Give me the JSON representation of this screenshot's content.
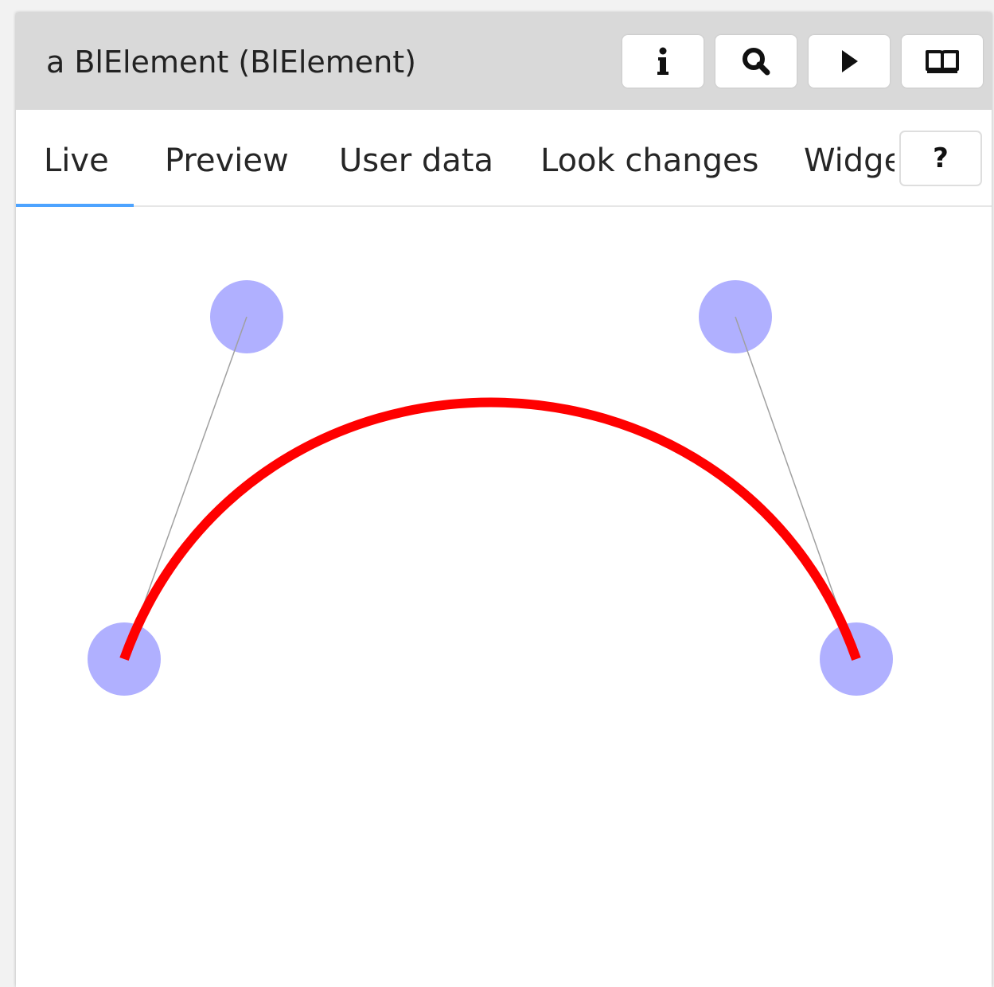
{
  "window": {
    "title": "a BlElement (BlElement)"
  },
  "toolbar": {
    "buttons": [
      {
        "name": "info",
        "icon": "info-icon"
      },
      {
        "name": "search",
        "icon": "search-icon"
      },
      {
        "name": "play",
        "icon": "play-icon"
      },
      {
        "name": "book",
        "icon": "book-icon"
      }
    ]
  },
  "tabs": {
    "items": [
      {
        "label": "Live",
        "active": true
      },
      {
        "label": "Preview",
        "active": false
      },
      {
        "label": "User data",
        "active": false
      },
      {
        "label": "Look changes",
        "active": false
      },
      {
        "label": "Widget",
        "active": false
      }
    ],
    "help_label": "?",
    "accent_color": "#4da3ff"
  },
  "canvas": {
    "curve_color": "#ff0000",
    "handle_color": "#b0b0ff",
    "control_line_color": "#a0a0a0"
  }
}
